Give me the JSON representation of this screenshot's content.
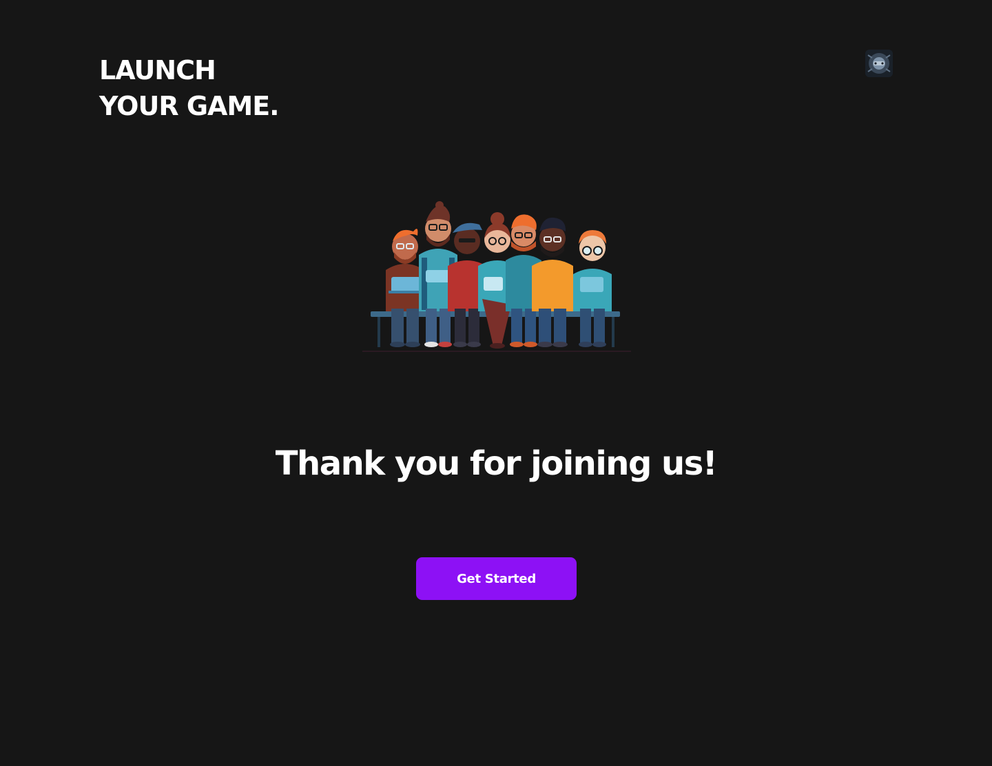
{
  "brand": {
    "line1": "LAUNCH",
    "line2": "YOUR GAME."
  },
  "header": {
    "avatar_icon": "user-avatar-icon"
  },
  "illustration": {
    "icon": "developer-team-illustration"
  },
  "main": {
    "headline": "Thank you for joining us!",
    "cta_label": "Get Started"
  },
  "colors": {
    "background": "#161616",
    "accent": "#8d11f5",
    "text": "#ffffff"
  }
}
